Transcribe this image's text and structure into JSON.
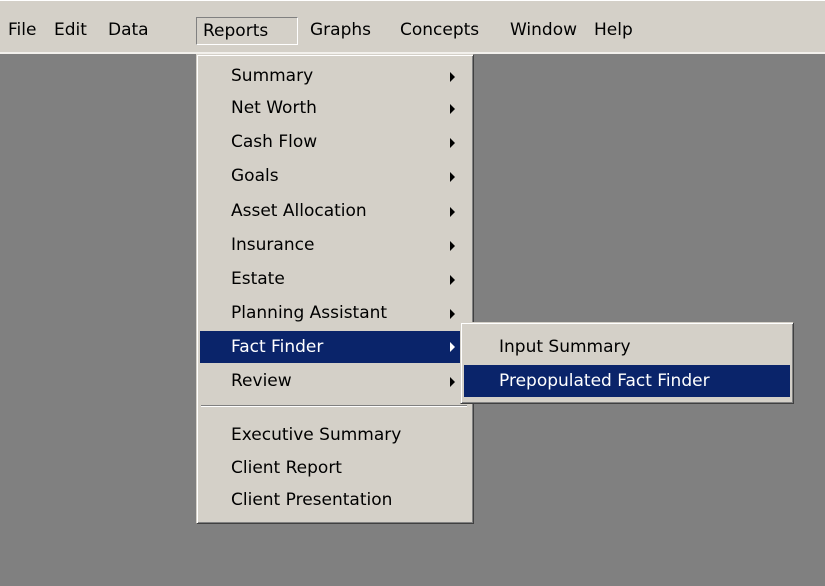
{
  "menubar": {
    "items": [
      {
        "label": "File"
      },
      {
        "label": "Edit"
      },
      {
        "label": "Data"
      },
      {
        "label": "Reports"
      },
      {
        "label": "Graphs"
      },
      {
        "label": "Concepts"
      },
      {
        "label": "Window"
      },
      {
        "label": "Help"
      }
    ]
  },
  "reports_menu": {
    "items": [
      {
        "label": "Summary",
        "submenu": true
      },
      {
        "label": "Net Worth",
        "submenu": true
      },
      {
        "label": "Cash Flow",
        "submenu": true
      },
      {
        "label": "Goals",
        "submenu": true
      },
      {
        "label": "Asset Allocation",
        "submenu": true
      },
      {
        "label": "Insurance",
        "submenu": true
      },
      {
        "label": "Estate",
        "submenu": true
      },
      {
        "label": "Planning Assistant",
        "submenu": true
      },
      {
        "label": "Fact Finder",
        "submenu": true,
        "selected": true
      },
      {
        "label": "Review",
        "submenu": true
      },
      {
        "label": "Executive Summary"
      },
      {
        "label": "Client Report"
      },
      {
        "label": "Client Presentation"
      }
    ]
  },
  "fact_finder_submenu": {
    "items": [
      {
        "label": "Input Summary"
      },
      {
        "label": "Prepopulated Fact Finder",
        "selected": true
      }
    ]
  },
  "colors": {
    "menu_background": "#d4d0c8",
    "selection": "#0a246a",
    "desktop": "#808080"
  }
}
